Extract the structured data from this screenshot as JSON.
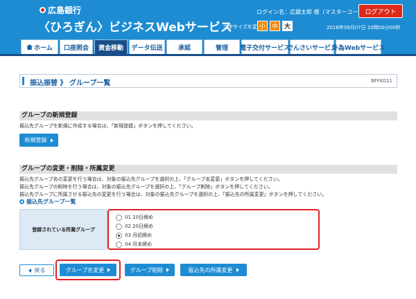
{
  "header": {
    "bank_name": "広島銀行",
    "service_name": "〈ひろぎん〉ビジネスWebサービス",
    "login_text": "ログイン名：広銀太郎 様（マスターユーザ）",
    "logout_label": "ログアウト",
    "fontsize_label": "文字サイズを変更",
    "fontsize_small": "小",
    "fontsize_medium": "中",
    "fontsize_large": "大",
    "datetime": "2016年09月07日 10時00分00秒"
  },
  "nav": {
    "items": [
      {
        "label": "ホーム"
      },
      {
        "label": "口座照会"
      },
      {
        "label": "資金移動"
      },
      {
        "label": "データ伝送"
      },
      {
        "label": "承認"
      },
      {
        "label": "管理"
      },
      {
        "label": "電子交付サービス"
      },
      {
        "label": "でんさいサービス"
      },
      {
        "label": "外為Webサービス"
      }
    ],
    "active_index": 2
  },
  "page": {
    "title": "振込振替 》 グループ一覧",
    "screen_id": "BFFK011"
  },
  "new_section": {
    "heading": "グループの新規登録",
    "description": "振込先グループを新規に作成する場合は、「新規登録」ボタンを押してください。",
    "button_label": "新規登録"
  },
  "change_section": {
    "heading": "グループの変更・削除・所属変更",
    "descriptions": [
      "振込先グループ名の変更を行う場合は、対象の振込先グループを選択の上、「グループ名変更」ボタンを押してください。",
      "振込先グループの削除を行う場合は、対象の振込先グループを選択の上、「グループ削除」ボタンを押してください。",
      "振込先グループに所属させる振込先の変更を行う場合は、対象の振込先グループを選択の上、「振込先の所属変更」ボタンを押してください。"
    ],
    "list_heading": "振込先グループ一覧",
    "group_label": "登録されている所属グループ",
    "groups": [
      {
        "label": "01 10日締め",
        "selected": false
      },
      {
        "label": "02 20日締め",
        "selected": false
      },
      {
        "label": "03 月初締め",
        "selected": true
      },
      {
        "label": "04 月末締め",
        "selected": false
      }
    ]
  },
  "actions": {
    "back_label": "戻る",
    "rename_label": "グループ名変更",
    "delete_label": "グループ削除",
    "member_change_label": "振込先の所属変更"
  },
  "colors": {
    "header_blue": "#1d8cd3",
    "nav_active": "#1a4e8a",
    "highlight_red": "#e02020",
    "logout_red": "#e02818"
  }
}
